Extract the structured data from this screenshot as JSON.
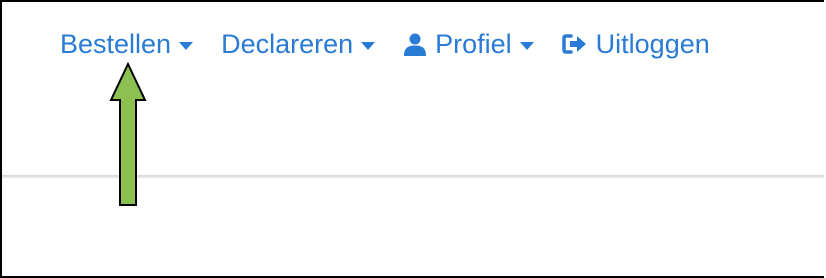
{
  "nav": {
    "items": [
      {
        "label": "Bestellen",
        "has_dropdown": true,
        "icon": null
      },
      {
        "label": "Declareren",
        "has_dropdown": true,
        "icon": null
      },
      {
        "label": "Profiel",
        "has_dropdown": true,
        "icon": "user-icon"
      },
      {
        "label": "Uitloggen",
        "has_dropdown": false,
        "icon": "sign-out-icon"
      }
    ]
  },
  "colors": {
    "link": "#2a7bd6",
    "arrow_fill": "#8cc152",
    "arrow_stroke": "#000000"
  },
  "annotation": {
    "type": "arrow",
    "direction": "up",
    "points_to": "Bestellen"
  }
}
